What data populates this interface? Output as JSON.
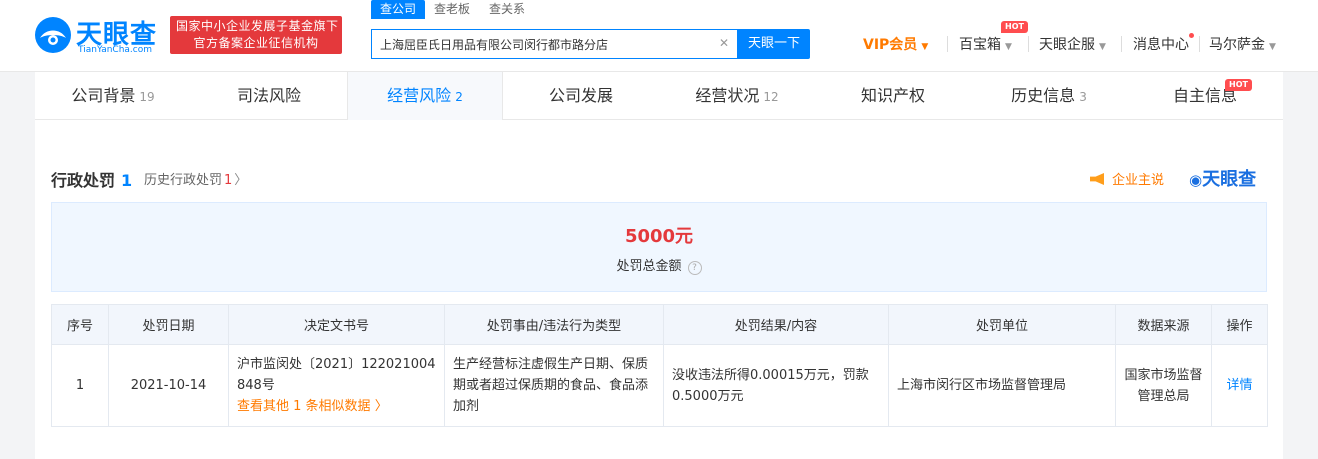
{
  "header": {
    "logo": {
      "name": "天眼查",
      "sub": "TianYanCha.com"
    },
    "badge": {
      "line1": "国家中小企业发展子基金旗下",
      "line2": "官方备案企业征信机构"
    },
    "search_tabs": [
      "查公司",
      "查老板",
      "查关系"
    ],
    "search": {
      "value": "上海屈臣氏日用品有限公司闵行都市路分店",
      "button": "天眼一下"
    },
    "nav": {
      "vip": "VIP会员",
      "baibao": "百宝箱",
      "qifu": "天眼企服",
      "msg": "消息中心",
      "user": "马尔萨金",
      "hot": "HOT"
    }
  },
  "tabs": [
    {
      "label": "公司背景",
      "count": "19"
    },
    {
      "label": "司法风险",
      "count": ""
    },
    {
      "label": "经营风险",
      "count": "2"
    },
    {
      "label": "公司发展",
      "count": ""
    },
    {
      "label": "经营状况",
      "count": "12"
    },
    {
      "label": "知识产权",
      "count": ""
    },
    {
      "label": "历史信息",
      "count": "3"
    },
    {
      "label": "自主信息",
      "count": ""
    }
  ],
  "section": {
    "title": "行政处罚",
    "count": "1",
    "history": {
      "label": "历史行政处罚",
      "count": "1"
    },
    "say": "企业主说",
    "watermark": "天眼查"
  },
  "summary": {
    "amount": "5000元",
    "label": "处罚总金额"
  },
  "table": {
    "headers": [
      "序号",
      "处罚日期",
      "决定文书号",
      "处罚事由/违法行为类型",
      "处罚结果/内容",
      "处罚单位",
      "数据来源",
      "操作"
    ],
    "rows": [
      {
        "no": "1",
        "date": "2021-10-14",
        "doc": "沪市监闵处〔2021〕122021004848号",
        "doc_link": "查看其他 1 条相似数据",
        "reason": "生产经营标注虚假生产日期、保质期或者超过保质期的食品、食品添加剂",
        "result": "没收违法所得0.00015万元，罚款0.5000万元",
        "unit": "上海市闵行区市场监督管理局",
        "source": "国家市场监督管理总局",
        "action": "详情"
      }
    ]
  }
}
